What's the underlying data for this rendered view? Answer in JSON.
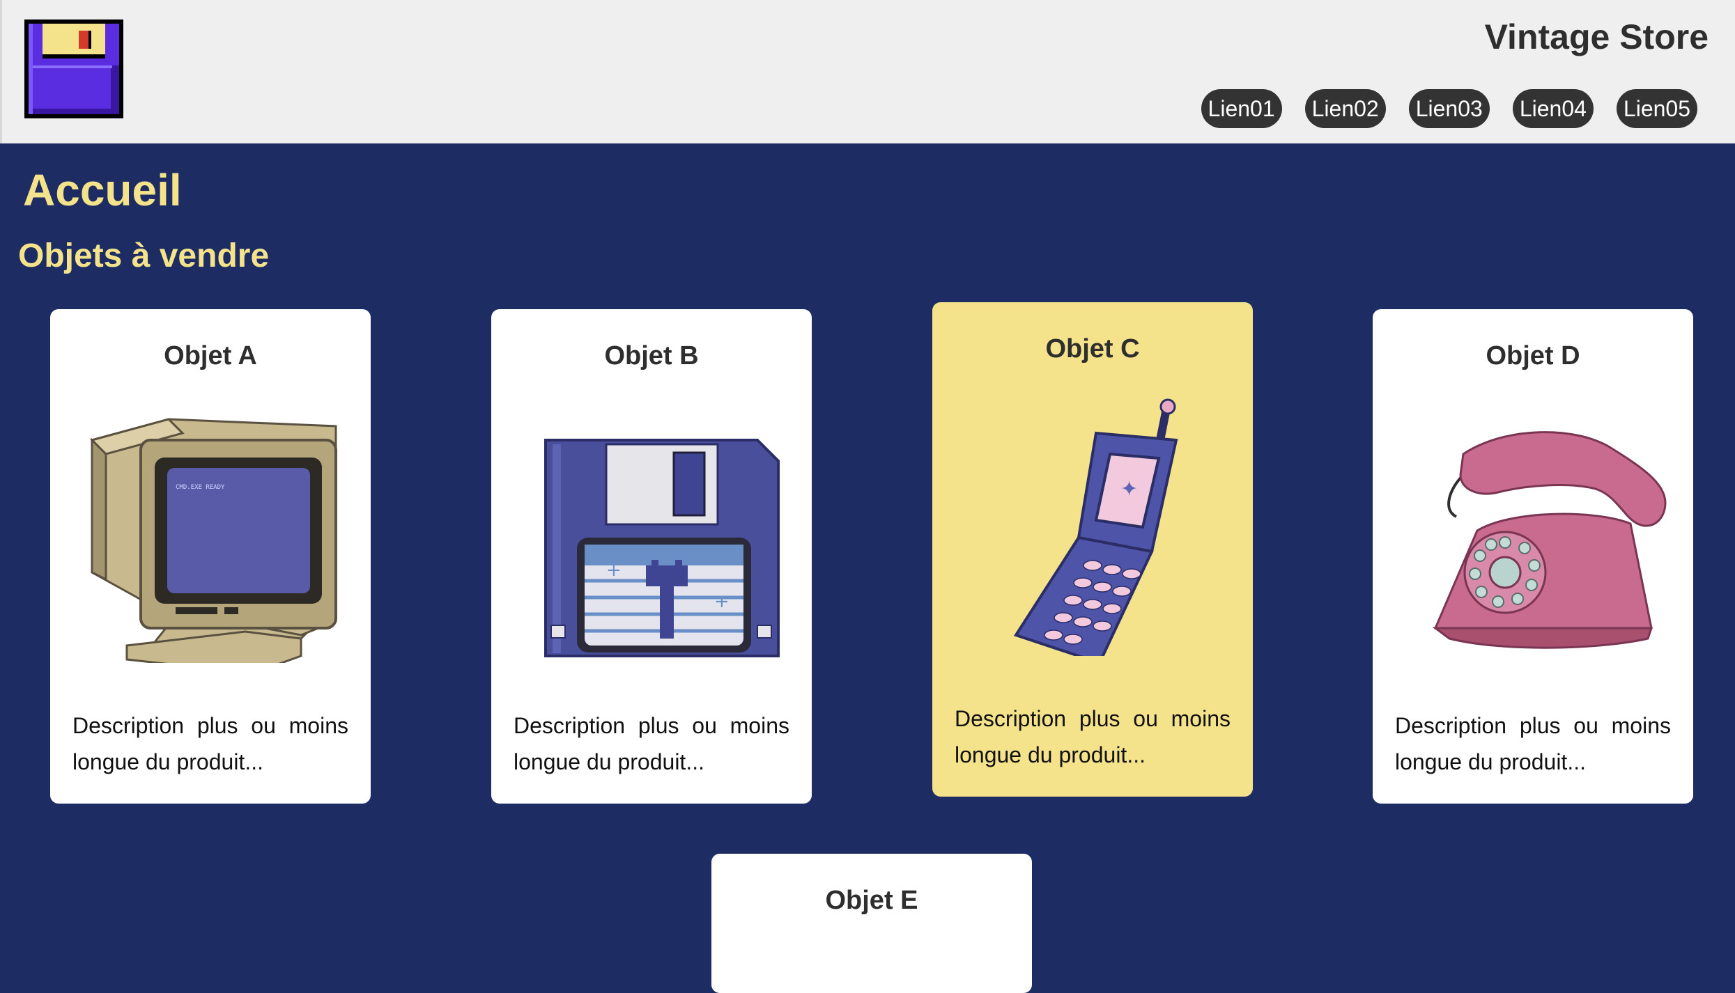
{
  "header": {
    "store_name": "Vintage Store",
    "logo_icon": "floppy-disk-icon",
    "nav": [
      "Lien01",
      "Lien02",
      "Lien03",
      "Lien04",
      "Lien05"
    ]
  },
  "main": {
    "title": "Accueil",
    "section_title": "Objets à vendre",
    "products": [
      {
        "name": "Objet A",
        "icon": "crt-monitor-icon",
        "description": "Description plus ou moins longue du produit..."
      },
      {
        "name": "Objet B",
        "icon": "floppy-disk-icon",
        "description": "Description plus ou moins longue du produit..."
      },
      {
        "name": "Objet C",
        "icon": "flip-phone-icon",
        "description": "Description plus ou moins longue du produit..."
      },
      {
        "name": "Objet D",
        "icon": "rotary-phone-icon",
        "description": "Description plus ou moins longue du produit..."
      },
      {
        "name": "Objet E"
      }
    ]
  },
  "colors": {
    "background": "#1d2d63",
    "accent": "#f4e38a",
    "header_bg": "#efefef",
    "nav_pill": "#333333"
  }
}
